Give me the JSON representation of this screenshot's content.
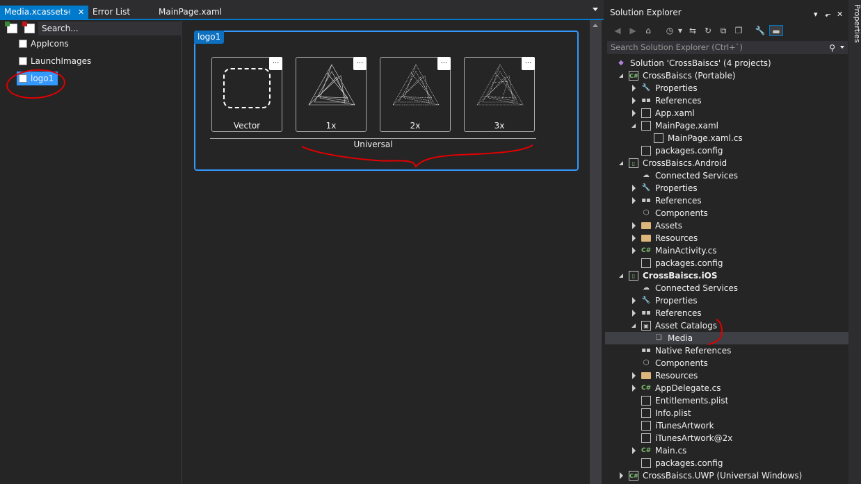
{
  "tabs": [
    {
      "label": "Media.xcassets",
      "active": true
    },
    {
      "label": "Error List",
      "active": false
    },
    {
      "label": "MainPage.xaml",
      "active": false
    }
  ],
  "tab_pin_glyph": "⌘",
  "tab_close_glyph": "✕",
  "asset_list": {
    "search_placeholder": "Search...",
    "items": [
      {
        "label": "AppIcons"
      },
      {
        "label": "LaunchImages"
      },
      {
        "label": "logo1",
        "selected": true
      }
    ]
  },
  "asset_set": {
    "name": "logo1",
    "slots": [
      {
        "label": "Vector",
        "menu": "..."
      },
      {
        "label": "1x",
        "menu": "..."
      },
      {
        "label": "2x",
        "menu": "..."
      },
      {
        "label": "3x",
        "menu": "..."
      }
    ],
    "group_label": "Universal"
  },
  "solution_explorer": {
    "title": "Solution Explorer",
    "title_buttons": [
      "▾",
      "⬐",
      "✕"
    ],
    "search_placeholder": "Search Solution Explorer (Ctrl+`)",
    "tree": [
      {
        "label": "Solution 'CrossBaiscs' (4 projects)",
        "icon": "solution",
        "indent": 0,
        "exp": "none"
      },
      {
        "label": "CrossBaiscs (Portable)",
        "icon": "csproj",
        "indent": 1,
        "exp": "expanded"
      },
      {
        "label": "Properties",
        "icon": "wrench",
        "indent": 2,
        "exp": "collapsed"
      },
      {
        "label": "References",
        "icon": "refs",
        "indent": 2,
        "exp": "collapsed"
      },
      {
        "label": "App.xaml",
        "icon": "file",
        "indent": 2,
        "exp": "collapsed"
      },
      {
        "label": "MainPage.xaml",
        "icon": "file",
        "indent": 2,
        "exp": "expanded"
      },
      {
        "label": "MainPage.xaml.cs",
        "icon": "file",
        "indent": 3,
        "exp": "none"
      },
      {
        "label": "packages.config",
        "icon": "file",
        "indent": 2,
        "exp": "none"
      },
      {
        "label": "CrossBaiscs.Android",
        "icon": "device",
        "indent": 1,
        "exp": "expanded"
      },
      {
        "label": "Connected Services",
        "icon": "cloud",
        "indent": 2,
        "exp": "none"
      },
      {
        "label": "Properties",
        "icon": "wrench",
        "indent": 2,
        "exp": "collapsed"
      },
      {
        "label": "References",
        "icon": "refs",
        "indent": 2,
        "exp": "collapsed"
      },
      {
        "label": "Components",
        "icon": "cube",
        "indent": 2,
        "exp": "none"
      },
      {
        "label": "Assets",
        "icon": "folder",
        "indent": 2,
        "exp": "collapsed"
      },
      {
        "label": "Resources",
        "icon": "folder",
        "indent": 2,
        "exp": "collapsed"
      },
      {
        "label": "MainActivity.cs",
        "icon": "cs",
        "indent": 2,
        "exp": "collapsed"
      },
      {
        "label": "packages.config",
        "icon": "file",
        "indent": 2,
        "exp": "none"
      },
      {
        "label": "CrossBaiscs.iOS",
        "icon": "device",
        "indent": 1,
        "exp": "expanded",
        "bold": true
      },
      {
        "label": "Connected Services",
        "icon": "cloud",
        "indent": 2,
        "exp": "none"
      },
      {
        "label": "Properties",
        "icon": "wrench",
        "indent": 2,
        "exp": "collapsed"
      },
      {
        "label": "References",
        "icon": "refs",
        "indent": 2,
        "exp": "collapsed"
      },
      {
        "label": "Asset Catalogs",
        "icon": "catalog",
        "indent": 2,
        "exp": "expanded"
      },
      {
        "label": "Media",
        "icon": "media",
        "indent": 3,
        "exp": "none",
        "selected": true
      },
      {
        "label": "Native References",
        "icon": "refs",
        "indent": 2,
        "exp": "none"
      },
      {
        "label": "Components",
        "icon": "cube",
        "indent": 2,
        "exp": "none"
      },
      {
        "label": "Resources",
        "icon": "folder",
        "indent": 2,
        "exp": "collapsed"
      },
      {
        "label": "AppDelegate.cs",
        "icon": "cs",
        "indent": 2,
        "exp": "collapsed"
      },
      {
        "label": "Entitlements.plist",
        "icon": "file",
        "indent": 2,
        "exp": "none"
      },
      {
        "label": "Info.plist",
        "icon": "file",
        "indent": 2,
        "exp": "none"
      },
      {
        "label": "iTunesArtwork",
        "icon": "file",
        "indent": 2,
        "exp": "none"
      },
      {
        "label": "iTunesArtwork@2x",
        "icon": "file",
        "indent": 2,
        "exp": "none"
      },
      {
        "label": "Main.cs",
        "icon": "cs",
        "indent": 2,
        "exp": "collapsed"
      },
      {
        "label": "packages.config",
        "icon": "file",
        "indent": 2,
        "exp": "none"
      },
      {
        "label": "CrossBaiscs.UWP (Universal Windows)",
        "icon": "csproj",
        "indent": 1,
        "exp": "collapsed"
      }
    ]
  },
  "side_tab": "Properties",
  "colors": {
    "accent": "#007acc",
    "selection": "#3399ff",
    "annotation": "#e00000"
  }
}
